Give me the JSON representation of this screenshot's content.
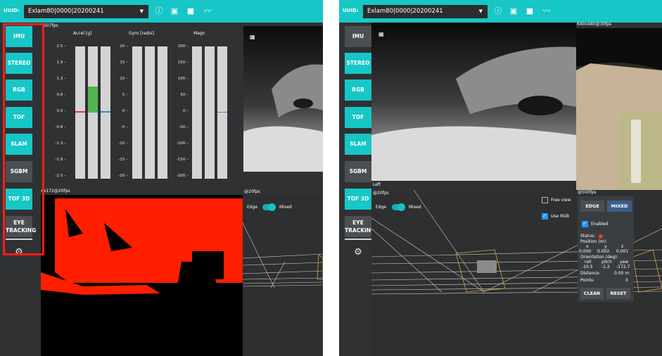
{
  "left_panel": {
    "uuid_label": "UUID:",
    "uuid_value": "Exlam80|0000|20200241",
    "sidebar": [
      "IMU",
      "STEREO",
      "RGB",
      "TOF",
      "SLAM",
      "SGBM",
      "TOF 3D",
      "EYE TRACKING"
    ],
    "imu_fps": "507fps",
    "accel_label": "Accel [g]",
    "gyro_label": "Gyro [rad/s]",
    "magn_label": "Magn",
    "accel_ticks": [
      "2.5",
      "1.9",
      "1.3",
      "0.6",
      "0.0",
      "-0.6",
      "-1.3",
      "-1.9",
      "-2.5"
    ],
    "gyro_ticks": [
      "20",
      "15",
      "10",
      "5",
      "0",
      "-5",
      "-10",
      "-15",
      "-20"
    ],
    "magn_ticks": [
      "200",
      "150",
      "100",
      "50",
      "0",
      "-50",
      "-100",
      "-150",
      "-200"
    ],
    "tof_label": "4x172@20fps",
    "pc_fps": "@20fps",
    "edge_label": "Edge",
    "mixed_label": "Mixed"
  },
  "right_panel": {
    "uuid_label": "UUID:",
    "uuid_value": "Exlam80|0000|20200241",
    "sidebar": [
      "IMU",
      "STEREO",
      "RGB",
      "TOF",
      "SLAM",
      "SGBM",
      "TOF 3D",
      "EYE TRACKING"
    ],
    "rgb_fps": "640x480@30fps",
    "left_label": "Left",
    "pc_fps": "@20fps",
    "edge_label": "Edge",
    "mixed_label": "Mixed",
    "free_view": "Free view",
    "use_rgb": "Use RGB",
    "slam_fps": "@500fps",
    "edge_btn": "EDGE",
    "mixed_btn": "MIXED",
    "enabled": "Enabled",
    "status": "Status:",
    "position_label": "Position (m):",
    "pos_head": [
      "x",
      "y",
      "z"
    ],
    "pos_vals": [
      "0.000",
      "0.002",
      "0.001"
    ],
    "orient_label": "Orientation (deg):",
    "orient_head": [
      "roll",
      "pitch",
      "yaw"
    ],
    "orient_vals": [
      "-10.5",
      "-1.2",
      "-172.7"
    ],
    "distance_label": "Distance:",
    "distance_val": "0.00 m",
    "points_label": "Points:",
    "points_val": "0",
    "clear": "CLEAR",
    "reset": "RESET"
  },
  "colors": {
    "accent": "#17c6c6",
    "panel": "#2f3133",
    "highlight": "#ff1d1d"
  }
}
